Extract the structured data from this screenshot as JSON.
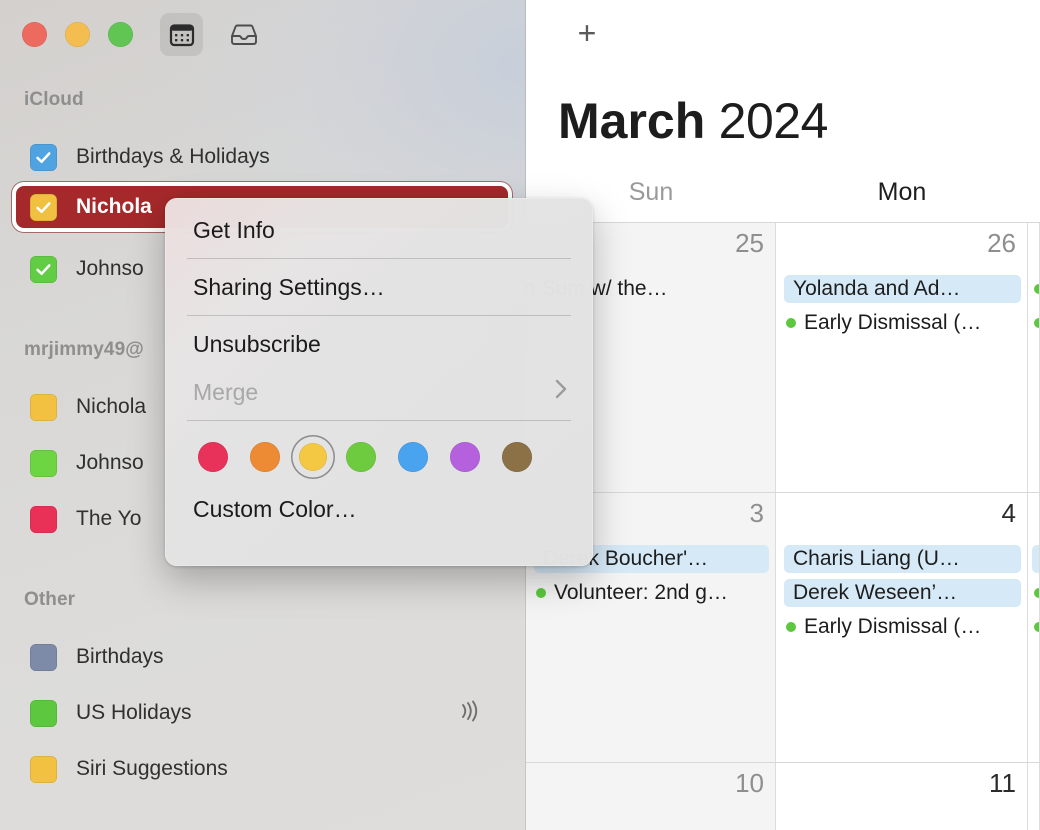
{
  "window": {
    "traffic_lights": [
      {
        "name": "close",
        "color": "#ed6a5e"
      },
      {
        "name": "minimize",
        "color": "#f4bd4f"
      },
      {
        "name": "zoom",
        "color": "#61c554"
      }
    ],
    "toolbar": [
      {
        "name": "calendar-view-button",
        "icon": "calendar-icon",
        "selected": true
      },
      {
        "name": "inbox-button",
        "icon": "inbox-tray-icon",
        "selected": false
      }
    ]
  },
  "sidebar": {
    "sections": [
      {
        "header": "iCloud",
        "items": [
          {
            "label": "Birthdays & Holidays",
            "color": "#4ea3e0",
            "checked": true,
            "selected": false,
            "subscribed": false
          },
          {
            "label": "Nichola",
            "color": "#f0c040",
            "checked": true,
            "selected": true,
            "subscribed": false
          },
          {
            "label": "Johnso",
            "color": "#62cc44",
            "checked": true,
            "selected": false,
            "subscribed": false
          }
        ]
      },
      {
        "header": "mrjimmy49@",
        "items": [
          {
            "label": "Nichola",
            "color": "#f2c141",
            "checked": false,
            "selected": false,
            "subscribed": false
          },
          {
            "label": "Johnso",
            "color": "#6dd442",
            "checked": false,
            "selected": false,
            "subscribed": false
          },
          {
            "label": "The Yo",
            "color": "#e93158",
            "checked": false,
            "selected": false,
            "subscribed": false
          }
        ]
      },
      {
        "header": "Other",
        "items": [
          {
            "label": "Birthdays",
            "color": "#7d8aa8",
            "checked": false,
            "selected": false,
            "subscribed": false
          },
          {
            "label": "US Holidays",
            "color": "#5cc73f",
            "checked": false,
            "selected": false,
            "subscribed": true
          },
          {
            "label": "Siri Suggestions",
            "color": "#f2c141",
            "checked": false,
            "selected": false,
            "subscribed": false
          }
        ]
      }
    ]
  },
  "context_menu": {
    "items": [
      {
        "label": "Get Info",
        "disabled": false,
        "submenu": false
      },
      {
        "label": "Sharing Settings…",
        "disabled": false,
        "submenu": false
      },
      {
        "label": "Unsubscribe",
        "disabled": false,
        "submenu": false
      },
      {
        "label": "Merge",
        "disabled": true,
        "submenu": true
      }
    ],
    "colors": [
      {
        "name": "red",
        "hex": "#e8325a",
        "selected": false
      },
      {
        "name": "orange",
        "hex": "#ec8b33",
        "selected": false
      },
      {
        "name": "yellow",
        "hex": "#f4c842",
        "selected": true
      },
      {
        "name": "green",
        "hex": "#6ecb3f",
        "selected": false
      },
      {
        "name": "blue",
        "hex": "#4aa3ee",
        "selected": false
      },
      {
        "name": "purple",
        "hex": "#b561dd",
        "selected": false
      },
      {
        "name": "brown",
        "hex": "#8b7145",
        "selected": false
      }
    ],
    "custom_color_label": "Custom Color…"
  },
  "calendar": {
    "add_label": "+",
    "month": "March",
    "year": "2024",
    "weekdays": [
      {
        "label": "Sun",
        "weekend": true
      },
      {
        "label": "Mon",
        "weekend": false
      }
    ],
    "rows": [
      {
        "days": [
          {
            "num": "25",
            "weekend": true,
            "events": [
              {
                "title": "n Sum w/ the…",
                "style": "plain",
                "dot": null
              }
            ]
          },
          {
            "num": "26",
            "weekend": false,
            "events": [
              {
                "title": "Yolanda and Ad…",
                "style": "block",
                "dot": null
              },
              {
                "title": "Early Dismissal (…",
                "style": "plain",
                "dot": "#5cc73f"
              }
            ]
          }
        ]
      },
      {
        "days": [
          {
            "num": "3",
            "weekend": true,
            "events": [
              {
                "title": "Derek Boucher'…",
                "style": "block",
                "dot": null
              },
              {
                "title": "Volunteer: 2nd g…",
                "style": "plain",
                "dot": "#5cc73f"
              }
            ]
          },
          {
            "num": "4",
            "weekend": false,
            "events": [
              {
                "title": "Charis Liang (U…",
                "style": "block",
                "dot": null
              },
              {
                "title": "Derek Weseen’…",
                "style": "block",
                "dot": null
              },
              {
                "title": "Early Dismissal (…",
                "style": "plain",
                "dot": "#5cc73f"
              }
            ]
          }
        ]
      },
      {
        "days": [
          {
            "num": "10",
            "weekend": true,
            "events": []
          },
          {
            "num": "11",
            "weekend": false,
            "events": []
          }
        ]
      }
    ]
  }
}
